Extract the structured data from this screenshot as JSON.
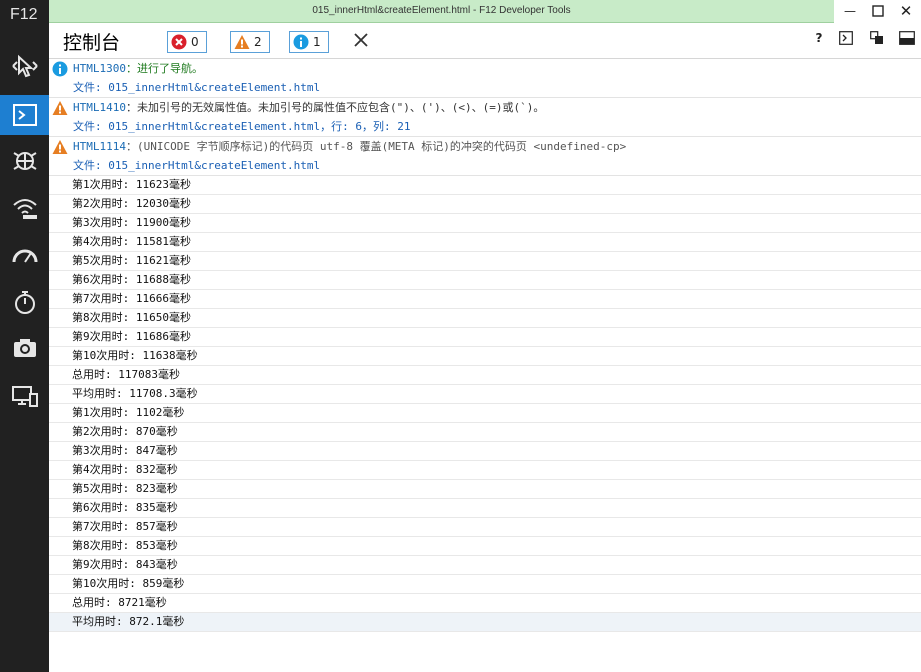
{
  "sidebar": {
    "label": "F12"
  },
  "titlebar": {
    "title": "015_innerHtml&createElement.html - F12 Developer Tools"
  },
  "header": {
    "title": "控制台",
    "errors": "0",
    "warnings": "2",
    "infos": "1",
    "help": "?"
  },
  "messages": [
    {
      "type": "info",
      "code": "HTML1300",
      "text": "：进行了导航。",
      "detail": "文件: 015_innerHtml&createElement.html"
    },
    {
      "type": "warning",
      "code": "HTML1410",
      "text": "：未加引号的无效属性值。未加引号的属性值不应包含(\")、(')、(<)、(=)或(`)。",
      "detail": "文件: 015_innerHtml&createElement.html，行: 6，列: 21"
    },
    {
      "type": "warning",
      "code": "HTML1114",
      "text": "：(UNICODE 字节顺序标记)的代码页 utf-8 覆盖(META 标记)的冲突的代码页 <undefined-cp>",
      "detail": "文件: 015_innerHtml&createElement.html"
    }
  ],
  "logs": [
    "第1次用时: 11623毫秒",
    "第2次用时: 12030毫秒",
    "第3次用时: 11900毫秒",
    "第4次用时: 11581毫秒",
    "第5次用时: 11621毫秒",
    "第6次用时: 11688毫秒",
    "第7次用时: 11666毫秒",
    "第8次用时: 11650毫秒",
    "第9次用时: 11686毫秒",
    "第10次用时: 11638毫秒",
    "总用时: 117083毫秒",
    "平均用时: 11708.3毫秒",
    "第1次用时: 1102毫秒",
    "第2次用时: 870毫秒",
    "第3次用时: 847毫秒",
    "第4次用时: 832毫秒",
    "第5次用时: 823毫秒",
    "第6次用时: 835毫秒",
    "第7次用时: 857毫秒",
    "第8次用时: 853毫秒",
    "第9次用时: 843毫秒",
    "第10次用时: 859毫秒",
    "总用时: 8721毫秒",
    "平均用时: 872.1毫秒"
  ],
  "colors": {
    "accent": "#1e7fd1",
    "sidebar": "#212121",
    "titlebar": "#c8ebc8",
    "info": "#1a9be0",
    "warning": "#e67e22",
    "error": "#d9202b"
  }
}
